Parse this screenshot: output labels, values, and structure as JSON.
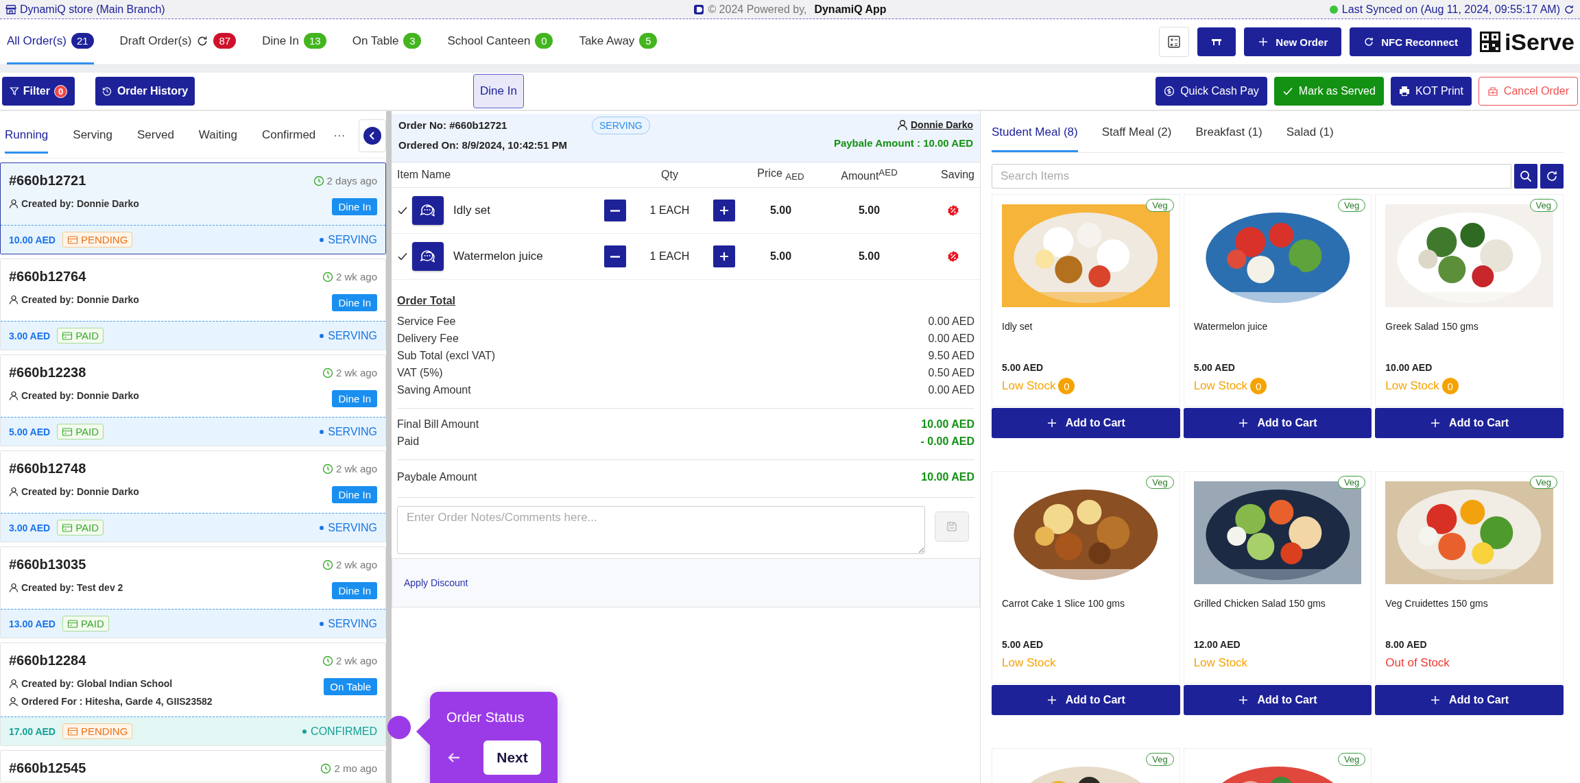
{
  "top_bar": {
    "store": "DynamiQ store (Main Branch)",
    "powered_by": "© 2024 Powered by,",
    "brand": "DynamiQ App",
    "sync": "Last Synced on (Aug 11, 2024, 09:55:17 AM)"
  },
  "order_tabs": [
    {
      "label": "All Order(s)",
      "count": "21",
      "color": "#1e2299",
      "selected": true,
      "refresh": false
    },
    {
      "label": "Draft Order(s)",
      "count": "87",
      "color": "#d0112b",
      "selected": false,
      "refresh": true
    },
    {
      "label": "Dine In",
      "count": "13",
      "color": "#43b51f",
      "selected": false,
      "refresh": false
    },
    {
      "label": "On Table",
      "count": "3",
      "color": "#43b51f",
      "selected": false,
      "refresh": false
    },
    {
      "label": "School Canteen",
      "count": "0",
      "color": "#43b51f",
      "selected": false,
      "refresh": false
    },
    {
      "label": "Take Away",
      "count": "5",
      "color": "#43b51f",
      "selected": false,
      "refresh": false
    }
  ],
  "toolbar": {
    "new_order": "New Order",
    "nfc": "NFC Reconnect",
    "logo": "iServe"
  },
  "action_bar": {
    "filter": "Filter",
    "filter_count": "0",
    "history": "Order History",
    "service": "Dine In",
    "buttons": [
      {
        "label": "Quick Cash Pay",
        "kind": "cash"
      },
      {
        "label": "Mark as Served",
        "kind": "served"
      },
      {
        "label": "KOT Print",
        "kind": "print"
      },
      {
        "label": "Cancel Order",
        "kind": "cancel"
      }
    ]
  },
  "status_tabs": [
    {
      "label": "Running",
      "selected": true
    },
    {
      "label": "Serving",
      "selected": false
    },
    {
      "label": "Served",
      "selected": false
    },
    {
      "label": "Waiting",
      "selected": false
    },
    {
      "label": "Confirmed",
      "selected": false
    }
  ],
  "status_more": "···",
  "orders": [
    {
      "id": "#660b12721",
      "time": "2 days ago",
      "created_by": "Created by: Donnie Darko",
      "service": "Dine In",
      "amount": "10.00 AED",
      "payment": {
        "label": "PENDING",
        "kind": "pending"
      },
      "status": {
        "label": "SERVING",
        "kind": "serving"
      },
      "selected": true
    },
    {
      "id": "#660b12764",
      "time": "2 wk ago",
      "created_by": "Created by: Donnie Darko",
      "service": "Dine In",
      "amount": "3.00 AED",
      "payment": {
        "label": "PAID",
        "kind": "paid"
      },
      "status": {
        "label": "SERVING",
        "kind": "serving"
      },
      "selected": false
    },
    {
      "id": "#660b12238",
      "time": "2 wk ago",
      "created_by": "Created by: Donnie Darko",
      "service": "Dine In",
      "amount": "5.00 AED",
      "payment": {
        "label": "PAID",
        "kind": "paid"
      },
      "status": {
        "label": "SERVING",
        "kind": "serving"
      },
      "selected": false
    },
    {
      "id": "#660b12748",
      "time": "2 wk ago",
      "created_by": "Created by: Donnie Darko",
      "service": "Dine In",
      "amount": "3.00 AED",
      "payment": {
        "label": "PAID",
        "kind": "paid"
      },
      "status": {
        "label": "SERVING",
        "kind": "serving"
      },
      "selected": false
    },
    {
      "id": "#660b13035",
      "time": "2 wk ago",
      "created_by": "Created by: Test dev 2",
      "service": "Dine In",
      "amount": "13.00 AED",
      "payment": {
        "label": "PAID",
        "kind": "paid"
      },
      "status": {
        "label": "SERVING",
        "kind": "serving"
      },
      "selected": false
    },
    {
      "id": "#660b12284",
      "time": "2 wk ago",
      "created_by": "Created by: Global Indian School",
      "ordered_for": "Ordered For : Hitesha, Garde 4, GIIS23582",
      "service": "On Table",
      "amount": "17.00 AED",
      "payment": {
        "label": "PENDING",
        "kind": "pending"
      },
      "status": {
        "label": "CONFIRMED",
        "kind": "confirmed"
      },
      "selected": false
    },
    {
      "id": "#660b12545",
      "time": "2 mo ago",
      "selected": false
    }
  ],
  "order": {
    "order_no": "Order No: #660b12721",
    "ordered_on": "Ordered On: 8/9/2024, 10:42:51 PM",
    "status": "SERVING",
    "customer": "Donnie Darko",
    "payable": "Paybale Amount : 10.00 AED",
    "columns": [
      "Item Name",
      "Qty",
      "Price $_{AED}$",
      "Amount$^{AED}$",
      "Saving"
    ],
    "items": [
      {
        "name": "Idly set",
        "qty": "1 EACH",
        "price": "5.00",
        "amount": "5.00",
        "checked": true
      },
      {
        "name": "Watermelon juice",
        "qty": "1 EACH",
        "price": "5.00",
        "amount": "5.00",
        "checked": true
      }
    ],
    "total_title": "Order Total",
    "lines": [
      {
        "label": "Service Fee",
        "value": "0.00 AED"
      },
      {
        "label": "Delivery Fee",
        "value": "0.00 AED"
      },
      {
        "label": "Sub Total (excl VAT)",
        "value": "9.50 AED"
      },
      {
        "label": "VAT (5%)",
        "value": "0.50 AED"
      },
      {
        "label": "Saving Amount",
        "value": "0.00 AED"
      }
    ],
    "final_lines": [
      {
        "label": "Final Bill Amount",
        "value": "10.00 AED"
      },
      {
        "label": "Paid",
        "value": "- 0.00 AED"
      }
    ],
    "payable_line": {
      "label": "Paybale Amount",
      "value": "10.00 AED"
    },
    "notes_placeholder": "Enter Order Notes/Comments here...",
    "discount": "Apply Discount"
  },
  "categories": [
    {
      "label": "Student Meal (8)",
      "selected": true
    },
    {
      "label": "Staff Meal (2)",
      "selected": false
    },
    {
      "label": "Breakfast (1)",
      "selected": false
    },
    {
      "label": "Salad (1)",
      "selected": false
    }
  ],
  "search": {
    "placeholder": "Search Items"
  },
  "products": [
    {
      "kind": "picture",
      "badge": "Veg",
      "name": "Idly set",
      "price": "5.00 AED",
      "stock": {
        "label": "Low Stock",
        "kind": "low",
        "count": "0"
      },
      "button": "Add to Cart"
    },
    {
      "kind": "picture",
      "badge": "Veg",
      "name": "Watermelon juice",
      "price": "5.00 AED",
      "stock": {
        "label": "Low Stock",
        "kind": "low",
        "count": "0"
      },
      "button": "Add to Cart"
    },
    {
      "kind": "picture",
      "badge": "Veg",
      "name": "Greek Salad 150 gms",
      "price": "10.00 AED",
      "stock": {
        "label": "Low Stock",
        "kind": "low",
        "count": "0"
      },
      "button": "Add to Cart"
    },
    {
      "kind": "picture",
      "badge": "Veg",
      "name": "Carrot Cake 1 Slice 100 gms",
      "price": "5.00 AED",
      "stock": {
        "label": "Low Stock",
        "kind": "low"
      },
      "button": "Add to Cart"
    },
    {
      "kind": "picture",
      "badge": "Veg",
      "name": "Grilled Chicken Salad 150 gms",
      "price": "12.00 AED",
      "stock": {
        "label": "Low Stock",
        "kind": "low"
      },
      "button": "Add to Cart"
    },
    {
      "kind": "picture",
      "badge": "Veg",
      "name": "Veg Cruidettes 150 gms",
      "price": "8.00 AED",
      "stock": {
        "label": "Out of Stock",
        "kind": "out"
      },
      "button": "Add to Cart"
    },
    {
      "kind": "picture",
      "badge": "Veg"
    },
    {
      "kind": "picture",
      "badge": "Veg"
    }
  ],
  "tour": {
    "title": "Order Status",
    "next": "Next"
  }
}
